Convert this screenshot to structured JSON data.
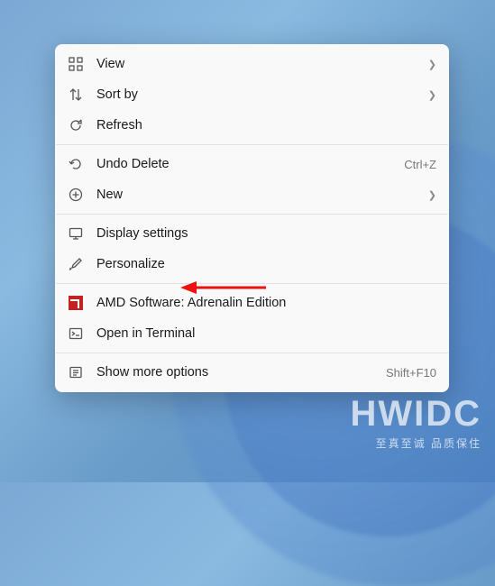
{
  "menu": {
    "sections": [
      [
        {
          "icon": "grid-icon",
          "label": "View",
          "submenu": true
        },
        {
          "icon": "sort-icon",
          "label": "Sort by",
          "submenu": true
        },
        {
          "icon": "refresh-icon",
          "label": "Refresh"
        }
      ],
      [
        {
          "icon": "undo-icon",
          "label": "Undo Delete",
          "shortcut": "Ctrl+Z"
        },
        {
          "icon": "add-icon",
          "label": "New",
          "submenu": true
        }
      ],
      [
        {
          "icon": "display-icon",
          "label": "Display settings"
        },
        {
          "icon": "brush-icon",
          "label": "Personalize",
          "highlight": true
        }
      ],
      [
        {
          "icon": "amd-icon",
          "label": "AMD Software: Adrenalin Edition"
        },
        {
          "icon": "terminal-icon",
          "label": "Open in Terminal"
        }
      ],
      [
        {
          "icon": "more-icon",
          "label": "Show more options",
          "shortcut": "Shift+F10"
        }
      ]
    ]
  },
  "annotation": {
    "target": "Personalize",
    "color": "#e11"
  },
  "watermark": {
    "big": "HWIDC",
    "small": "至真至诚  品质保住"
  }
}
